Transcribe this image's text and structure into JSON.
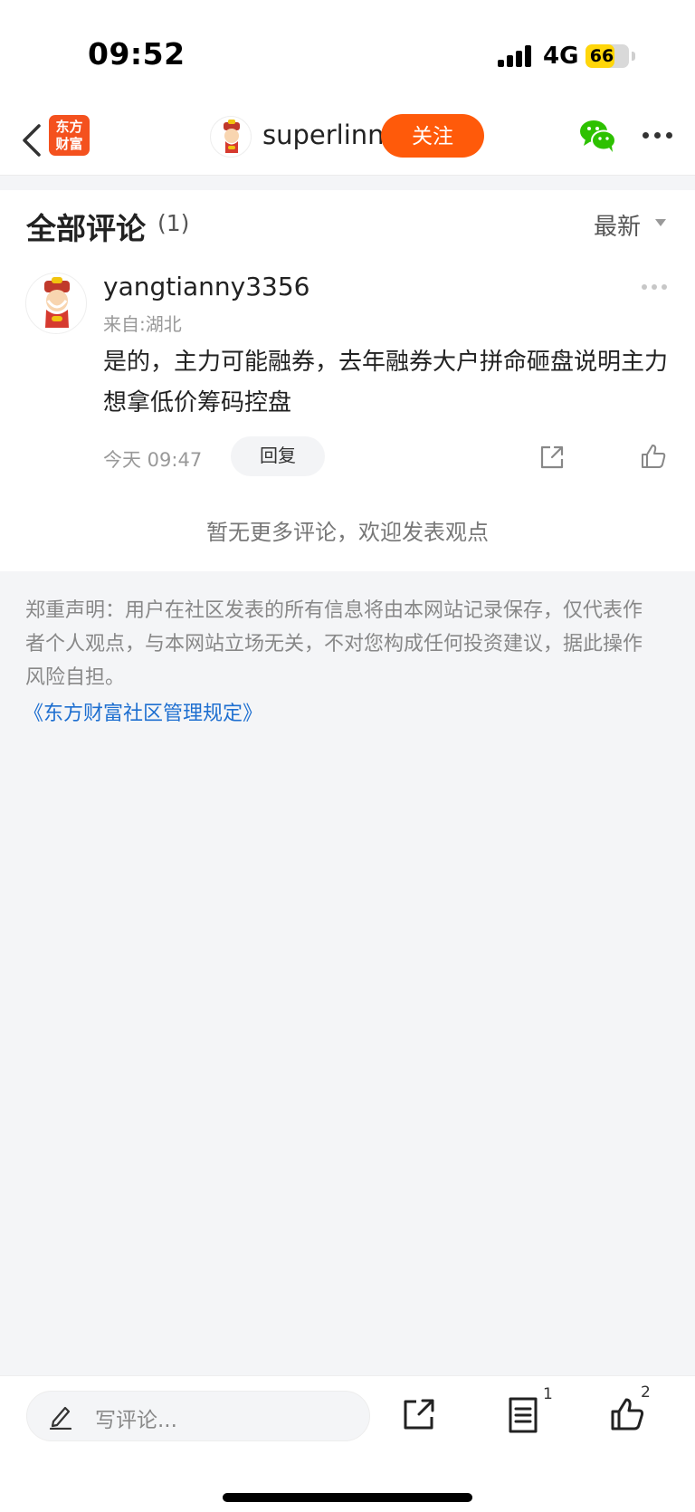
{
  "status_bar": {
    "time": "09:52",
    "network": "4G",
    "battery": "66",
    "battery_level": 0.66
  },
  "nav": {
    "app_logo_line1": "东方",
    "app_logo_line2": "财富",
    "username": "superlinn",
    "follow_label": "关注"
  },
  "comments_section": {
    "title": "全部评论",
    "count": "(1)",
    "sort_label": "最新",
    "comments": [
      {
        "username": "yangtianny3356",
        "location": "来自:湖北",
        "text": "是的，主力可能融券，去年融券大户拼命砸盘说明主力想拿低价筹码控盘",
        "time": "今天 09:47",
        "reply_label": "回复"
      }
    ],
    "no_more": "暂无更多评论，欢迎发表观点"
  },
  "disclaimer": {
    "text": "郑重声明：用户在社区发表的所有信息将由本网站记录保存，仅代表作者个人观点，与本网站立场无关，不对您构成任何投资建议，据此操作风险自担。",
    "rules_link": "《东方财富社区管理规定》"
  },
  "bottom_bar": {
    "input_placeholder": "写评论...",
    "comment_count": "1",
    "like_count": "2"
  },
  "colors": {
    "accent": "#ff5a0a",
    "logo": "#f4511e",
    "wechat": "#2dc100",
    "link": "#1e6fd0"
  }
}
